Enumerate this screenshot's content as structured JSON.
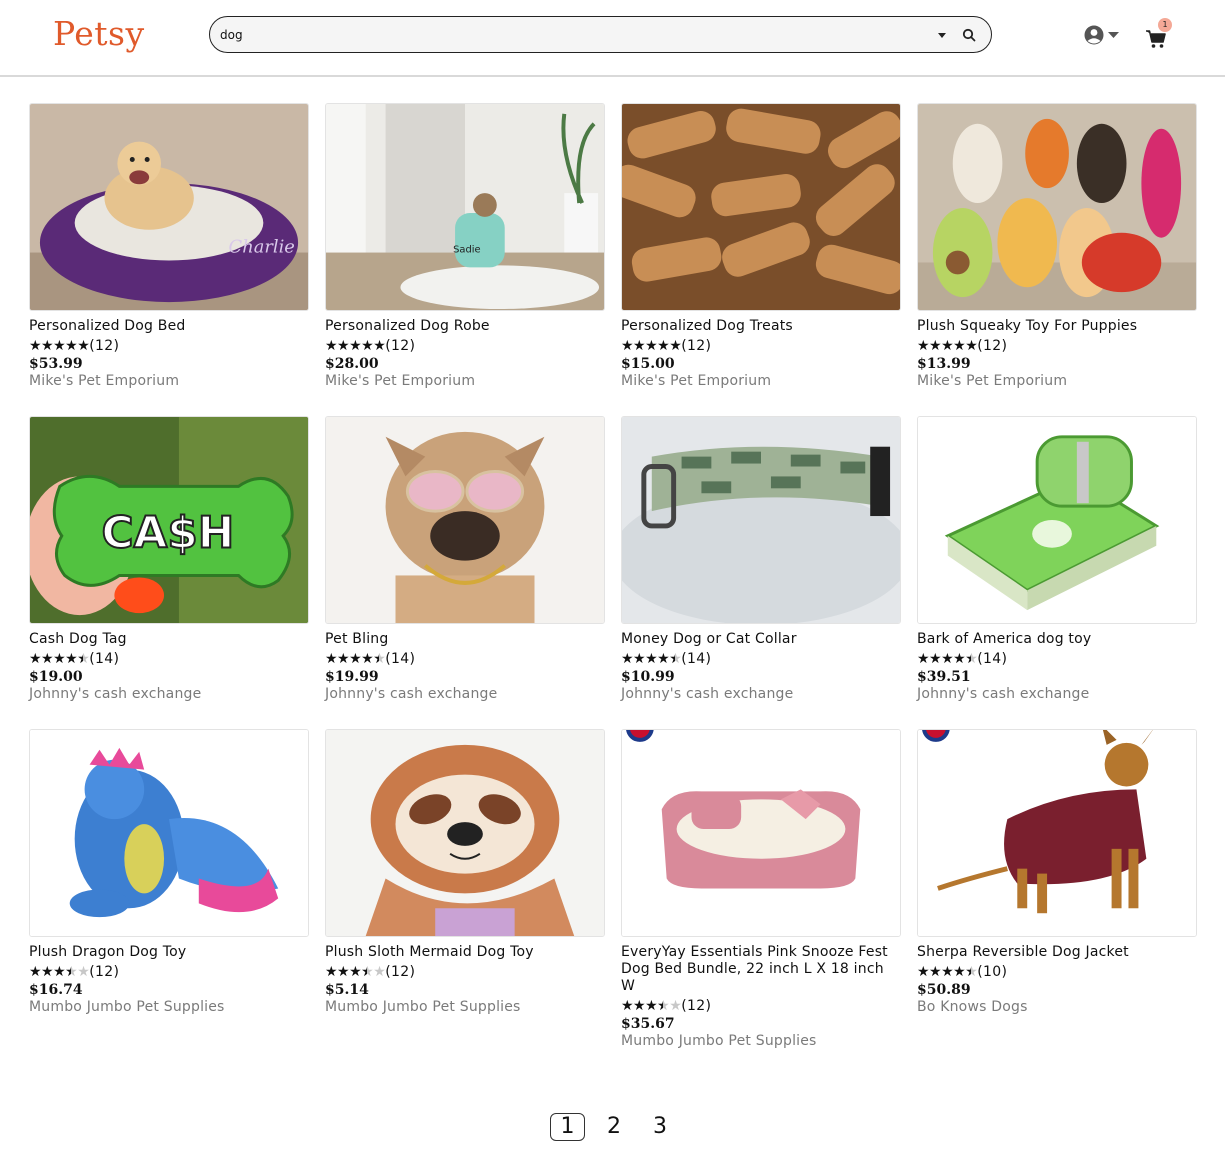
{
  "brand": {
    "name": "Petsy",
    "color": "#e05a2b"
  },
  "search": {
    "value": "dog",
    "placeholder": ""
  },
  "header": {
    "account_icon": "user-circle-icon",
    "cart_icon": "cart-icon",
    "cart_count": "1"
  },
  "products": [
    {
      "title": "Personalized Dog Bed",
      "rating": 5,
      "reviews": "(12)",
      "price": "$53.99",
      "shop": "Mike's Pet Emporium"
    },
    {
      "title": "Personalized Dog Robe",
      "rating": 5,
      "reviews": "(12)",
      "price": "$28.00",
      "shop": "Mike's Pet Emporium"
    },
    {
      "title": "Personalized Dog Treats",
      "rating": 5,
      "reviews": "(12)",
      "price": "$15.00",
      "shop": "Mike's Pet Emporium"
    },
    {
      "title": "Plush Squeaky Toy For Puppies",
      "rating": 5,
      "reviews": "(12)",
      "price": "$13.99",
      "shop": "Mike's Pet Emporium"
    },
    {
      "title": "Cash Dog Tag",
      "rating": 4.5,
      "reviews": "(14)",
      "price": "$19.00",
      "shop": "Johnny's cash exchange"
    },
    {
      "title": "Pet Bling",
      "rating": 4.5,
      "reviews": "(14)",
      "price": "$19.99",
      "shop": "Johnny's cash exchange"
    },
    {
      "title": "Money Dog or Cat Collar",
      "rating": 4.5,
      "reviews": "(14)",
      "price": "$10.99",
      "shop": "Johnny's cash exchange"
    },
    {
      "title": "Bark of America dog toy",
      "rating": 4.5,
      "reviews": "(14)",
      "price": "$39.51",
      "shop": "Johnny's cash exchange"
    },
    {
      "title": "Plush Dragon Dog Toy",
      "rating": 3.5,
      "reviews": "(12)",
      "price": "$16.74",
      "shop": "Mumbo Jumbo Pet Supplies"
    },
    {
      "title": "Plush Sloth Mermaid Dog Toy",
      "rating": 3.5,
      "reviews": "(12)",
      "price": "$5.14",
      "shop": "Mumbo Jumbo Pet Supplies"
    },
    {
      "title": "EveryYay Essentials Pink Snooze Fest Dog Bed Bundle, 22 inch L X 18 inch W",
      "rating": 3.5,
      "reviews": "(12)",
      "price": "$35.67",
      "shop": "Mumbo Jumbo Pet Supplies"
    },
    {
      "title": "Sherpa Reversible Dog Jacket",
      "rating": 4.5,
      "reviews": "(10)",
      "price": "$50.89",
      "shop": "Bo Knows Dogs"
    }
  ],
  "pagination": {
    "pages": [
      "1",
      "2",
      "3"
    ],
    "current": "1"
  }
}
